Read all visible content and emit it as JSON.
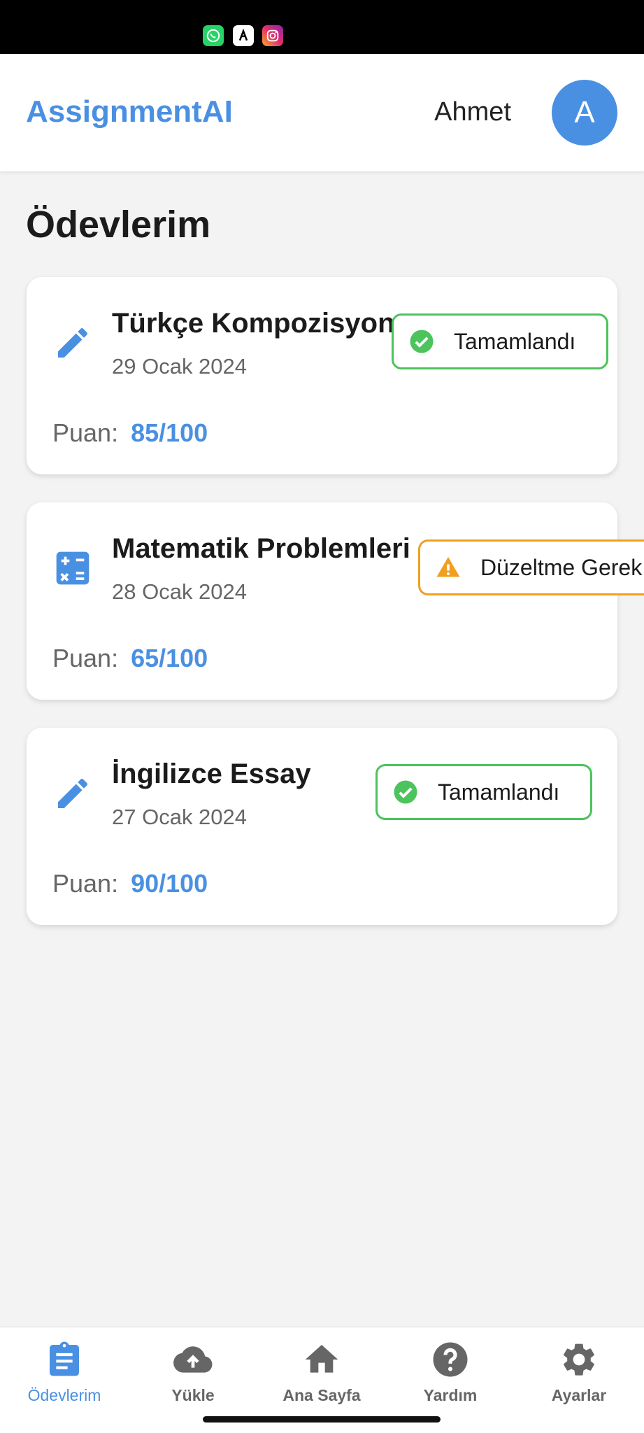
{
  "status_bar": {
    "notification_icons": [
      "whatsapp-icon",
      "app-icon",
      "instagram-icon"
    ]
  },
  "header": {
    "brand": "AssignmentAI",
    "user_name": "Ahmet",
    "avatar_letter": "A"
  },
  "page_title": "Ödevlerim",
  "assignments": [
    {
      "icon": "pencil-icon",
      "title": "Türkçe Kompozisyon",
      "date": "29 Ocak 2024",
      "status": "Tamamlandı",
      "status_icon": "check-circle-icon",
      "score_label": "Puan:",
      "score": "85/100"
    },
    {
      "icon": "calculator-icon",
      "title": "Matematik Problemleri",
      "date": "28 Ocak 2024",
      "status": "Düzeltme Gerek",
      "status_icon": "warning-icon",
      "score_label": "Puan:",
      "score": "65/100"
    },
    {
      "icon": "pencil-icon",
      "title": "İngilizce Essay",
      "date": "27 Ocak 2024",
      "status": "Tamamlandı",
      "status_icon": "check-circle-icon",
      "score_label": "Puan:",
      "score": "90/100"
    }
  ],
  "bottom_nav": [
    {
      "icon": "clipboard-icon",
      "label": "Ödevlerim",
      "active": true
    },
    {
      "icon": "cloud-upload-icon",
      "label": "Yükle",
      "active": false
    },
    {
      "icon": "home-icon",
      "label": "Ana Sayfa",
      "active": false
    },
    {
      "icon": "help-icon",
      "label": "Yardım",
      "active": false
    },
    {
      "icon": "gear-icon",
      "label": "Ayarlar",
      "active": false
    }
  ],
  "colors": {
    "accent": "#4a90e2",
    "success": "#4cc35c",
    "warning": "#f0a020",
    "nav_inactive": "#666666"
  }
}
